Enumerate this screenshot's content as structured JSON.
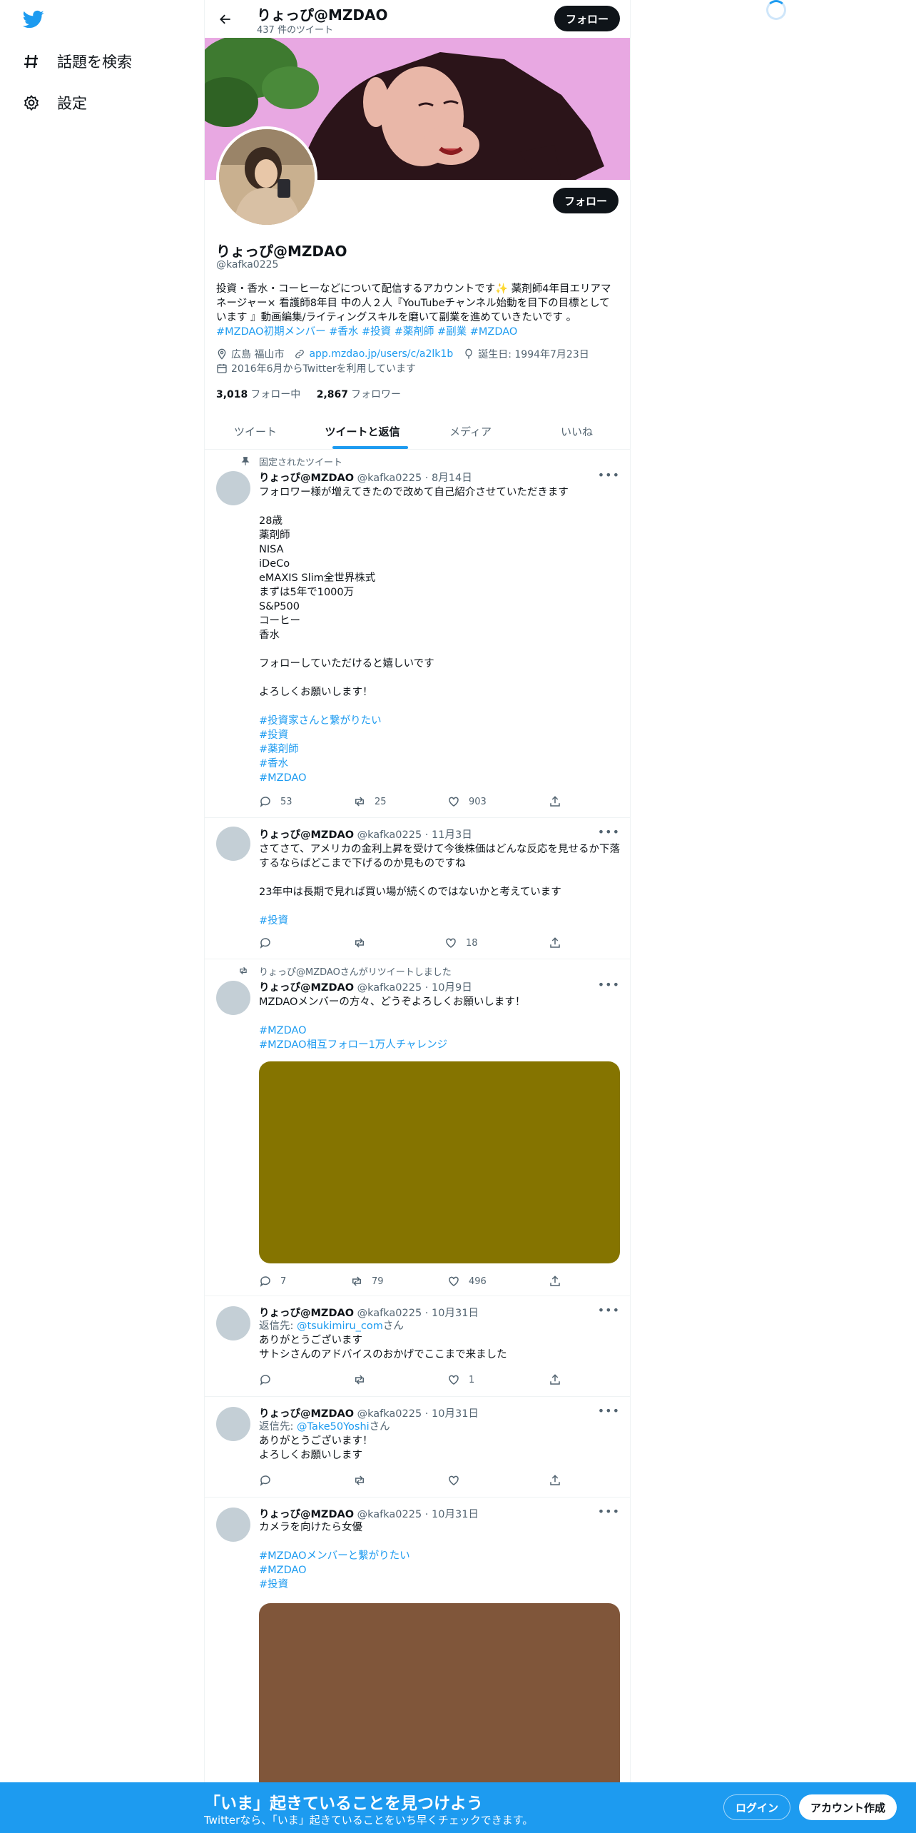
{
  "sidebar": {
    "items": [
      {
        "label": "話題を検索",
        "icon": "hashtag-icon"
      },
      {
        "label": "設定",
        "icon": "gear-icon"
      }
    ]
  },
  "header": {
    "name": "りょっぴ@MZDAO",
    "tweet_count": "437 件のツイート",
    "follow": "フォロー"
  },
  "profile": {
    "name": "りょっぴ@MZDAO",
    "handle": "@kafka0225",
    "follow": "フォロー",
    "bio_text": "投資・香水・コーヒーなどについて配信するアカウントです✨ 薬剤師4年目エリアマネージャー× 看護師8年目 中の人２人『YouTubeチャンネル始動を目下の目標としています 』動画編集/ライティングスキルを磨いて副業を進めていきたいです 。",
    "bio_tags": "#MZDAO初期メンバー #香水 #投資 #薬剤師 #副業 #MZDAO",
    "location": "広島 福山市",
    "url": "app.mzdao.jp/users/c/a2lk1b",
    "birthday": "誕生日: 1994年7月23日",
    "joined": "2016年6月からTwitterを利用しています",
    "following_count": "3,018",
    "following_label": "フォロー中",
    "followers_count": "2,867",
    "followers_label": "フォロワー"
  },
  "tabs": [
    "ツイート",
    "ツイートと返信",
    "メディア",
    "いいね"
  ],
  "tweets": [
    {
      "context": "固定されたツイート",
      "name": "りょっぴ@MZDAO",
      "meta": "@kafka0225 · 8月14日",
      "text": "フォロワー様が増えてきたので改めて自己紹介させていただきます\n\n28歳\n薬剤師\nNISA\niDeCo\neMAXIS Slim全世界株式\nまずは5年で1000万\nS&P500\nコーヒー\n香水\n\nフォローしていただけると嬉しいです\n\nよろしくお願いします！",
      "tags": "#投資家さんと繋がりたい\n#投資\n#薬剤師\n#香水\n#MZDAO",
      "reply": "53",
      "retweet": "25",
      "like": "903"
    },
    {
      "name": "りょっぴ@MZDAO",
      "meta": "@kafka0225 · 11月3日",
      "text": "さてさて、アメリカの金利上昇を受けて今後株価はどんな反応を見せるか下落するならばどこまで下げるのか見ものですね\n\n23年中は長期で見れば買い場が続くのではないかと考えています",
      "tags": "#投資",
      "reply": "",
      "retweet": "",
      "like": "18"
    },
    {
      "context": "りょっぴ@MZDAOさんがリツイートしました",
      "name": "りょっぴ@MZDAO",
      "meta": "@kafka0225 · 10月9日",
      "text": "MZDAOメンバーの方々、どうぞよろしくお願いします！",
      "tags": "#MZDAO\n #MZDAO相互フォロー1万人チャレンジ",
      "reply": "7",
      "retweet": "79",
      "like": "496",
      "media_color": "#857400"
    },
    {
      "name": "りょっぴ@MZDAO",
      "meta": "@kafka0225 · 10月31日",
      "reply_to_prefix": "返信先: ",
      "reply_to": "@tsukimiru_com",
      "reply_to_suffix": "さん",
      "text": "ありがとうございます\nサトシさんのアドバイスのおかげでここまで来ました",
      "reply": "",
      "retweet": "",
      "like": "1"
    },
    {
      "name": "りょっぴ@MZDAO",
      "meta": "@kafka0225 · 10月31日",
      "reply_to_prefix": "返信先: ",
      "reply_to": "@Take50Yoshi",
      "reply_to_suffix": "さん",
      "text": "ありがとうございます！\nよろしくお願いします",
      "reply": "",
      "retweet": "",
      "like": ""
    },
    {
      "name": "りょっぴ@MZDAO",
      "meta": "@kafka0225 · 10月31日",
      "text": "カメラを向けたら女優",
      "tags": "#MZDAOメンバーと繋がりたい\n#MZDAO\n#投資",
      "media_color": "#80563a"
    }
  ],
  "bottom_bar": {
    "title": "「いま」起きていることを見つけよう",
    "subtitle": "Twitterなら、「いま」起きていることをいち早くチェックできます。",
    "login": "ログイン",
    "signup": "アカウント作成"
  },
  "colors": {
    "accent": "#1d9bf0",
    "banner": "#e8a8e2"
  }
}
